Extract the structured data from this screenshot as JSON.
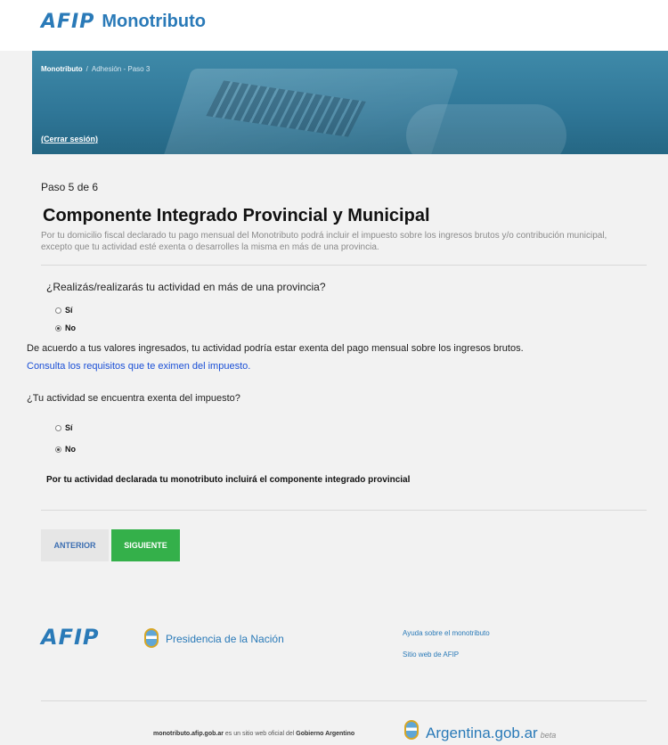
{
  "header": {
    "logo_text": "AFIP",
    "product_name": "Monotributo"
  },
  "hero": {
    "breadcrumb": {
      "root": "Monotributo",
      "separator": "/",
      "current": "Adhesión - Paso 3"
    },
    "logout": "(Cerrar sesión)"
  },
  "main": {
    "step": "Paso 5 de 6",
    "title": "Componente Integrado Provincial y Municipal",
    "description": "Por tu domicilio fiscal declarado tu pago mensual del Monotributo podrá incluir el impuesto sobre los ingresos brutos y/o contribución municipal, excepto que tu actividad esté exenta o desarrolles la misma en más de una provincia.",
    "question1": "¿Realizás/realizarás tu actividad en más de una provincia?",
    "question1_options": [
      {
        "label": "Sí",
        "selected": false
      },
      {
        "label": "No",
        "selected": true
      }
    ],
    "info": "De acuerdo a tus valores ingresados, tu actividad podría estar exenta del pago mensual sobre los ingresos brutos.",
    "requirements_link": "Consulta los requisitos que te eximen del impuesto.",
    "question2": "¿Tu actividad se encuentra exenta del impuesto?",
    "question2_options": [
      {
        "label": "Sí",
        "selected": false
      },
      {
        "label": "No",
        "selected": true
      }
    ],
    "conclusion": "Por tu actividad declarada tu monotributo incluirá el componente integrado provincial",
    "buttons": {
      "previous": "ANTERIOR",
      "next": "SIGUIENTE"
    }
  },
  "footer": {
    "logo_text": "AFIP",
    "presidencia": "Presidencia de la Nación",
    "links": [
      "Ayuda sobre el monotributo",
      "Sitio web de AFIP"
    ],
    "site_domain": "monotributo.afip.gob.ar",
    "site_text": "es un sitio web oficial del",
    "site_owner": "Gobierno Argentino",
    "brand": "Argentina.gob.ar",
    "brand_tag": "beta"
  },
  "colors": {
    "brand_blue": "#2a7ab8",
    "hero_blue": "#2f7697",
    "next_green": "#34b04a",
    "link_blue": "#1a4fd6"
  }
}
